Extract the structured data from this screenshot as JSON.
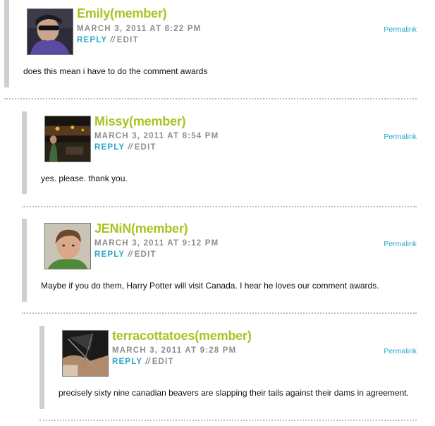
{
  "comments": [
    {
      "author": "Emily(member)",
      "date": "MARCH 3, 2011 AT 8:22 PM",
      "reply": "REPLY",
      "separator": "//",
      "edit": "EDIT",
      "permalink": "Permalink",
      "text": "does this mean i have to do the comment awards"
    },
    {
      "author": "Missy(member)",
      "date": "MARCH 3, 2011 AT 8:54 PM",
      "reply": "REPLY",
      "separator": "//",
      "edit": "EDIT",
      "permalink": "Permalink",
      "text": "yes. please. thank you."
    },
    {
      "author": "JENiN(member)",
      "date": "MARCH 3, 2011 AT 9:12 PM",
      "reply": "REPLY",
      "separator": "//",
      "edit": "EDIT",
      "permalink": "Permalink",
      "text": "Maybe if you do them, Harry Potter will visit Canada. I hear he loves our comment awards."
    },
    {
      "author": "terracottatoes(member)",
      "date": "MARCH 3, 2011 AT 9:28 PM",
      "reply": "REPLY",
      "separator": "//",
      "edit": "EDIT",
      "permalink": "Permalink",
      "text": "precisely sixty nine canadian beavers are slapping their tails against their dams in agreement."
    }
  ]
}
